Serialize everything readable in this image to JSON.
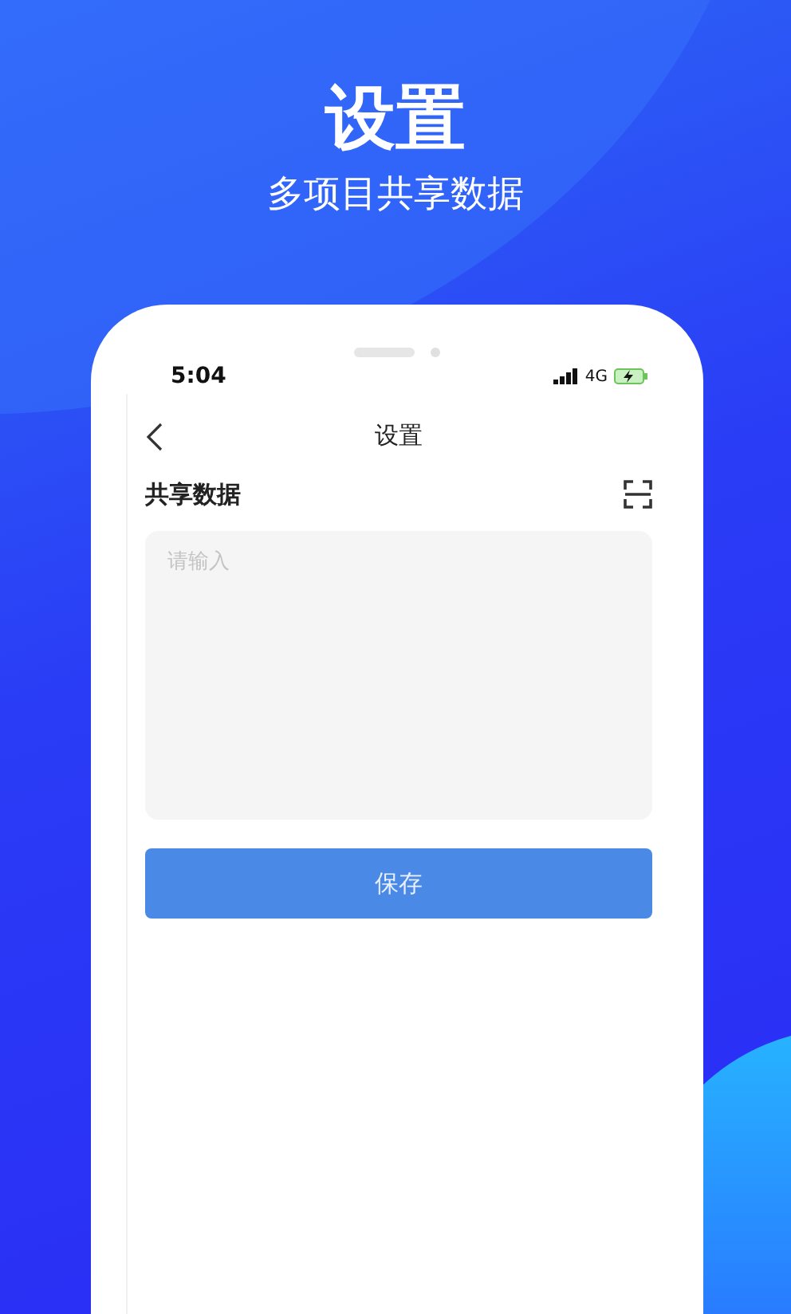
{
  "promo": {
    "title": "设置",
    "subtitle": "多项目共享数据"
  },
  "status_bar": {
    "time": "5:04",
    "network": "4G"
  },
  "nav": {
    "title": "设置"
  },
  "form": {
    "label": "共享数据",
    "placeholder": "请输入",
    "button": "保存"
  }
}
